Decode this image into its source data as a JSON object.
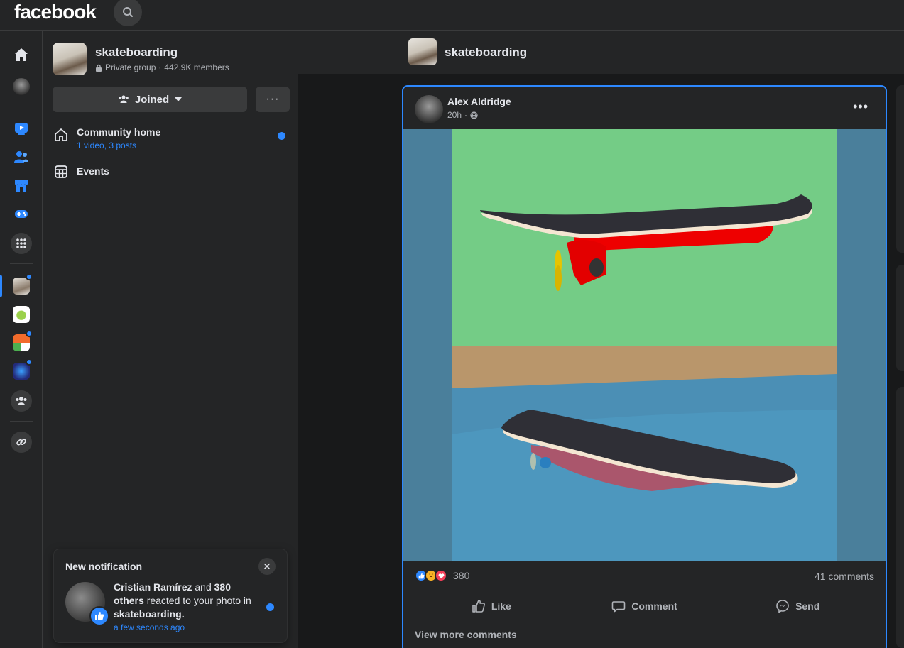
{
  "topbar": {
    "logo": "facebook"
  },
  "rail": {
    "items": [
      {
        "name": "home-icon"
      },
      {
        "name": "profile-avatar"
      },
      {
        "name": "watch-icon"
      },
      {
        "name": "friends-icon"
      },
      {
        "name": "marketplace-icon"
      },
      {
        "name": "gaming-icon"
      },
      {
        "name": "menu-grid-icon"
      },
      {
        "name": "group-skateboarding",
        "active": true,
        "unread": true
      },
      {
        "name": "group-2"
      },
      {
        "name": "group-3",
        "unread": true
      },
      {
        "name": "group-4",
        "unread": true
      },
      {
        "name": "groups-icon"
      },
      {
        "name": "link-icon"
      }
    ]
  },
  "group": {
    "name": "skateboarding",
    "privacy": "Private group",
    "separator": "·",
    "members": "442.9K members",
    "joined_label": "Joined",
    "more_label": "···"
  },
  "nav": {
    "community_home": "Community home",
    "community_home_sub": "1 video, 3 posts",
    "events": "Events"
  },
  "notification": {
    "title": "New notification",
    "actor": "Cristian Ramírez",
    "and_word": "and",
    "others": "380 others",
    "action_text": "reacted to your photo in",
    "group": "skateboarding.",
    "time": "a few seconds ago"
  },
  "feed_header": {
    "name": "skateboarding"
  },
  "post": {
    "author": "Alex Aldridge",
    "time": "20h",
    "time_sep": "·",
    "reaction_count": "380",
    "comments": "41 comments",
    "actions": {
      "like": "Like",
      "comment": "Comment",
      "send": "Send"
    },
    "view_more": "View more comments"
  },
  "colors": {
    "accent": "#2d88ff",
    "background": "#18191a",
    "surface": "#242526",
    "love": "#f33e58",
    "haha": "#f7b125"
  }
}
